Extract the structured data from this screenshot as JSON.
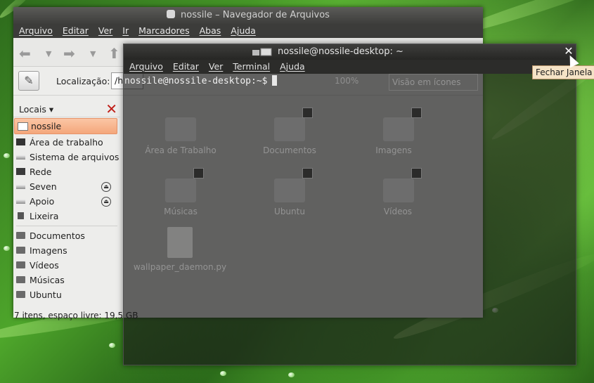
{
  "file_manager": {
    "title": "nossile – Navegador de Arquivos",
    "menu": [
      "Arquivo",
      "Editar",
      "Ver",
      "Ir",
      "Marcadores",
      "Abas",
      "Ajuda"
    ],
    "location_label": "Localização:",
    "location_value": "/h",
    "sidebar_title": "Locais",
    "sidebar_items": [
      {
        "label": "nossile",
        "icon": "home-icon",
        "selected": true
      },
      {
        "label": "Área de trabalho",
        "icon": "desktop-icon"
      },
      {
        "label": "Sistema de arquivos",
        "icon": "drive-icon"
      },
      {
        "label": "Rede",
        "icon": "network-icon"
      },
      {
        "label": "Seven",
        "icon": "drive-icon",
        "eject": true
      },
      {
        "label": "Apoio",
        "icon": "drive-icon",
        "eject": true
      },
      {
        "label": "Lixeira",
        "icon": "trash-icon"
      }
    ],
    "bookmarks": [
      "Documentos",
      "Imagens",
      "Vídeos",
      "Músicas",
      "Ubuntu"
    ],
    "status": "7 itens, espaço livre: 19,5 GB",
    "zoom": "100%",
    "view_mode": "Visão em ícones",
    "files": [
      {
        "name": "Área de Trabalho"
      },
      {
        "name": "Documentos"
      },
      {
        "name": "Imagens"
      },
      {
        "name": "Músicas"
      },
      {
        "name": "Ubuntu"
      },
      {
        "name": "Vídeos"
      },
      {
        "name": "wallpaper_daemon.py"
      }
    ]
  },
  "terminal": {
    "title": "nossile@nossile-desktop: ~",
    "menu": [
      "Arquivo",
      "Editar",
      "Ver",
      "Terminal",
      "Ajuda"
    ],
    "prompt": "nossile@nossile-desktop:~$"
  },
  "tooltip": "Fechar Janela"
}
